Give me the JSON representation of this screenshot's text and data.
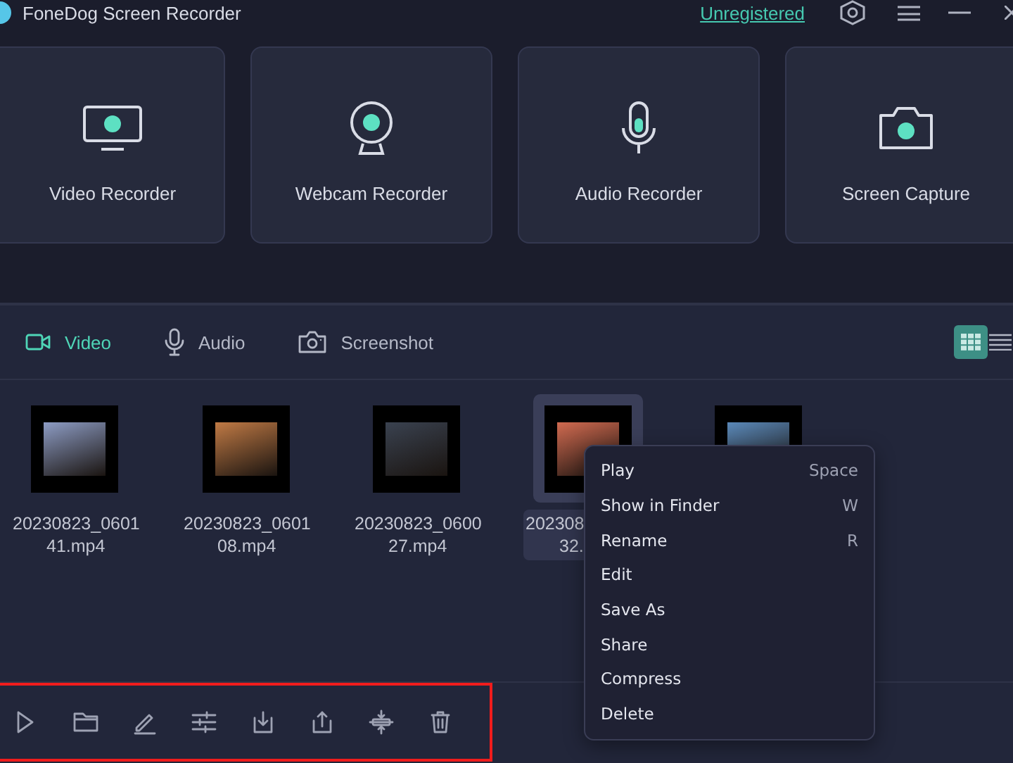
{
  "window": {
    "title": "FoneDog Screen Recorder",
    "account_link": "Unregistered"
  },
  "modes": [
    {
      "label": "Video Recorder",
      "kind": "monitor"
    },
    {
      "label": "Webcam Recorder",
      "kind": "webcam"
    },
    {
      "label": "Audio Recorder",
      "kind": "mic"
    },
    {
      "label": "Screen Capture",
      "kind": "camera"
    }
  ],
  "tabs": [
    {
      "label": "Video",
      "kind": "video",
      "selected": true
    },
    {
      "label": "Audio",
      "kind": "mic",
      "selected": false
    },
    {
      "label": "Screenshot",
      "kind": "camera",
      "selected": false
    }
  ],
  "view_toggle": [
    {
      "kind": "grid",
      "selected": true
    },
    {
      "kind": "list",
      "selected": false
    }
  ],
  "files": [
    {
      "name_lines": [
        "20230823_0601",
        "41.mp4"
      ],
      "selected": false
    },
    {
      "name_lines": [
        "20230823_0601",
        "08.mp4"
      ],
      "selected": false
    },
    {
      "name_lines": [
        "20230823_0600",
        "27.mp4"
      ],
      "selected": false
    },
    {
      "name_lines": [
        "202308",
        "32."
      ],
      "selected": true
    },
    {
      "selected": false
    }
  ],
  "context_menu": [
    {
      "label": "Play",
      "shortcut": "Space"
    },
    {
      "label": "Show in Finder",
      "shortcut": "W"
    },
    {
      "label": "Rename",
      "shortcut": "R"
    },
    {
      "label": "Edit"
    },
    {
      "label": "Save As"
    },
    {
      "label": "Share"
    },
    {
      "label": "Compress"
    },
    {
      "label": "Delete"
    }
  ]
}
